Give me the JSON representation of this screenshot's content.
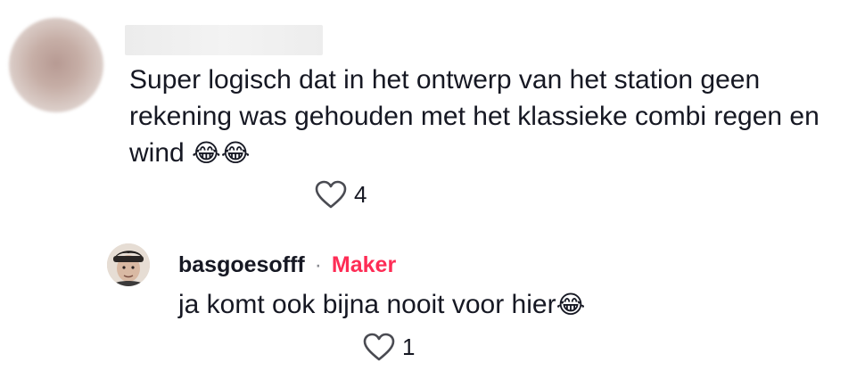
{
  "comment": {
    "text": "Super logisch dat in het ontwerp van het station geen rekening was gehouden met het klassieke combi regen en wind",
    "emoji": "😂😂",
    "likes": "4"
  },
  "reply": {
    "username": "basgoesofff",
    "separator": "·",
    "badge": "Maker",
    "text": "ja komt ook bijna nooit voor hier",
    "emoji": "😂",
    "likes": "1"
  },
  "colors": {
    "badge": "#fe2c55",
    "text": "#161823",
    "muted": "#8a8b91"
  },
  "icons": {
    "like": "heart-outline-icon"
  }
}
